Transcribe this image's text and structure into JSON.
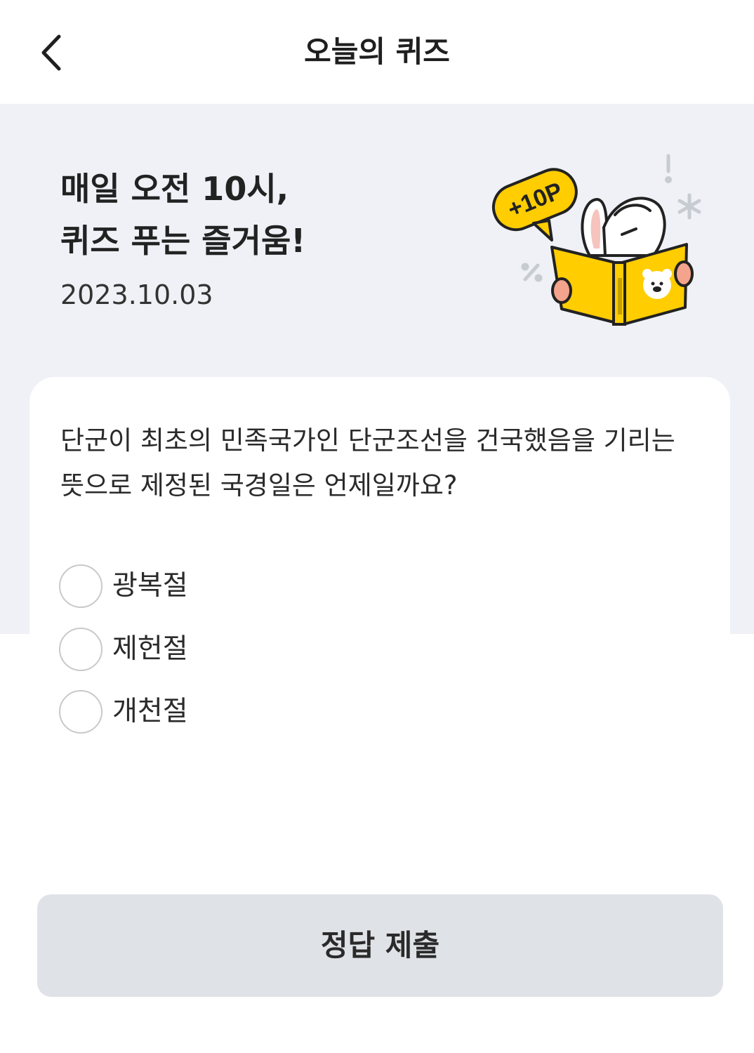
{
  "header": {
    "title": "오늘의 퀴즈"
  },
  "hero": {
    "line1": "매일 오전 10시,",
    "line2": "퀴즈 푸는 즐거움!",
    "date": "2023.10.03",
    "badge": "+10P"
  },
  "quiz": {
    "question": "단군이 최초의 민족국가인 단군조선을 건국했음을 기리는 뜻으로 제정된 국경일은 언제일까요?",
    "options": [
      {
        "label": "광복절"
      },
      {
        "label": "제헌절"
      },
      {
        "label": "개천절"
      }
    ]
  },
  "footer": {
    "submit_label": "정답 제출"
  },
  "colors": {
    "hero_background": "#eff1f6",
    "accent_yellow": "#ffcd00",
    "button_background": "#dfe2e6"
  }
}
